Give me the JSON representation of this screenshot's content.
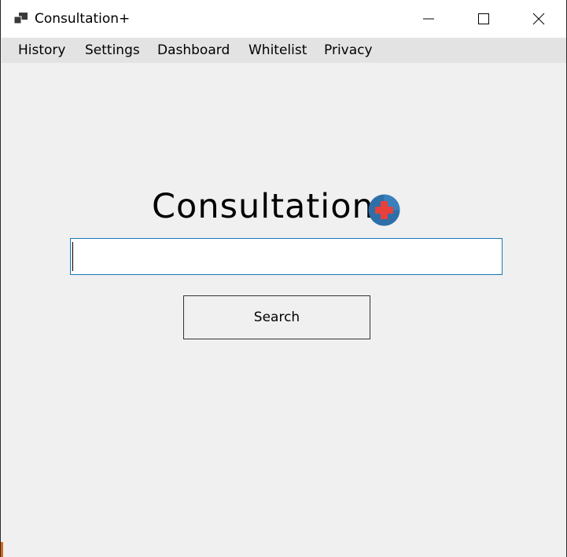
{
  "window": {
    "title": "Consultation+"
  },
  "titlebar_controls": {
    "minimize_icon": "minimize-icon",
    "maximize_icon": "maximize-icon",
    "close_icon": "close-icon"
  },
  "menu": {
    "items": [
      {
        "label": "History"
      },
      {
        "label": "Settings"
      },
      {
        "label": "Dashboard"
      },
      {
        "label": "Whitelist"
      },
      {
        "label": "Privacy"
      }
    ]
  },
  "main": {
    "heading": "Consultation",
    "heading_icon": "medical-cross-icon",
    "search_value": "",
    "search_button_label": "Search"
  },
  "colors": {
    "window_bg": "#f0f0f0",
    "menubar_bg": "#e3e3e3",
    "input_border": "#1a77b8",
    "icon_blue": "#2f6fa8",
    "icon_red": "#e8403a"
  }
}
